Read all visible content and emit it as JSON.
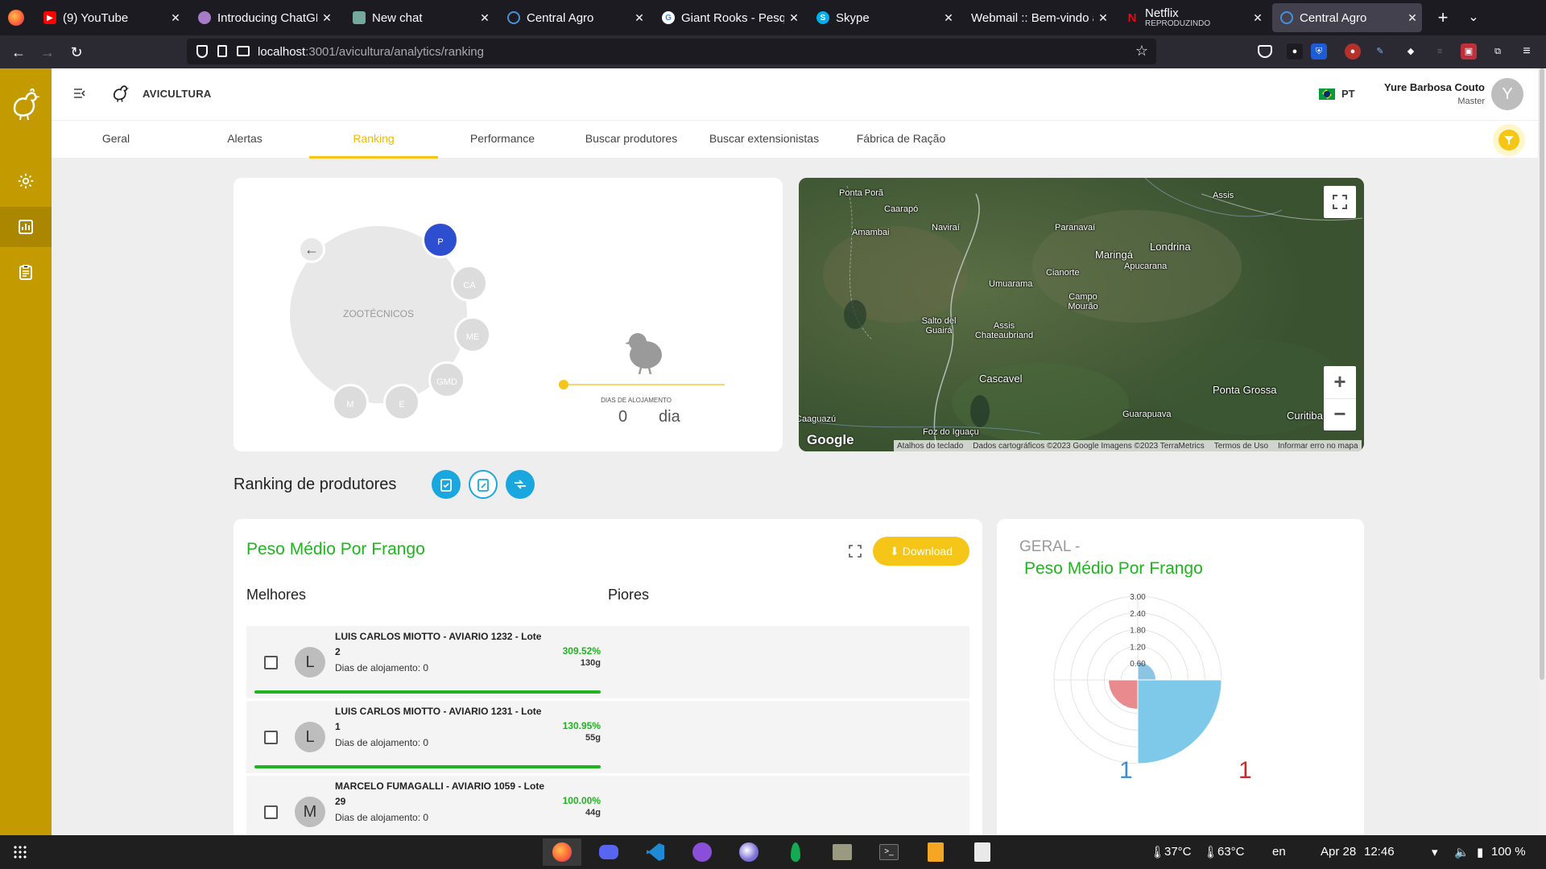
{
  "browser": {
    "tabs": [
      {
        "title": "(9) YouTube",
        "favicon": "youtube-icon",
        "color": "#ff0000"
      },
      {
        "title": "Introducing ChatGPT",
        "favicon": "openai-icon",
        "color": "#a77cc7"
      },
      {
        "title": "New chat",
        "favicon": "chatgpt-icon",
        "color": "#74aa9c"
      },
      {
        "title": "Central Agro",
        "favicon": "central-agro-icon",
        "color": "#4a90d9"
      },
      {
        "title": "Giant Rooks - Pesquisa",
        "favicon": "google-icon",
        "color": "#ffffff"
      },
      {
        "title": "Skype",
        "favicon": "skype-icon",
        "color": "#00aff0"
      },
      {
        "title": "Webmail :: Bem-vindo a",
        "favicon": "webmail-icon",
        "color": "#888888"
      },
      {
        "title": "Netflix",
        "subtitle": "REPRODUZINDO",
        "favicon": "netflix-icon",
        "color": "#e50914"
      },
      {
        "title": "Central Agro",
        "favicon": "central-agro-icon",
        "color": "#4a90d9"
      }
    ],
    "url_host": "localhost",
    "url_path": ":3001/avicultura/analytics/ranking"
  },
  "app": {
    "module_title": "AVICULTURA",
    "language": "PT",
    "user_name": "Yure Barbosa Couto",
    "user_role": "Master",
    "user_initial": "Y",
    "tabs": [
      "Geral",
      "Alertas",
      "Ranking",
      "Performance",
      "Buscar produtores",
      "Buscar extensionistas",
      "Fábrica de Ração"
    ],
    "active_tab": "Ranking",
    "accent": "#f5c518",
    "sidebar_color": "#c39a00"
  },
  "selector": {
    "center_label": "ZOOTÉCNICOS",
    "options": [
      "P",
      "CA",
      "ME",
      "GMD",
      "E",
      "M"
    ],
    "selected": "P",
    "days_label": "DIAS DE ALOJAMENTO",
    "days_value": "0",
    "days_unit": "dia",
    "slider_value": 0
  },
  "map": {
    "labels": [
      "Ponta Porã",
      "Caarapó",
      "Amambai",
      "Naviraí",
      "Paranavaí",
      "Maringá",
      "Londrina",
      "Apucarana",
      "Assis",
      "Umuarama",
      "Cianorte",
      "Campo Mourão",
      "Salto del Guairá",
      "Assis Chateaubriand",
      "Cascavel",
      "Ponta Grossa",
      "Guarapuava",
      "Foz do Iguaçu",
      "Caaguazú",
      "Curitiba"
    ],
    "logo": "Google",
    "attribution": [
      "Atalhos do teclado",
      "Dados cartográficos ©2023 Google Imagens ©2023 TerraMetrics",
      "Termos de Uso",
      "Informar erro no mapa"
    ],
    "zoom_in": "+",
    "zoom_out": "−"
  },
  "ranking": {
    "heading": "Ranking de produtores",
    "card_title": "Peso Médio Por Frango",
    "download_label": "Download",
    "best_label": "Melhores",
    "worst_label": "Piores",
    "rows": [
      {
        "initial": "L",
        "name": "LUIS CARLOS MIOTTO - AVIARIO 1232 - Lote 2",
        "days": "Dias de alojamento: 0",
        "pct": "309.52%",
        "grams": "130g",
        "bar_fraction": 1.0
      },
      {
        "initial": "L",
        "name": "LUIS CARLOS MIOTTO - AVIARIO 1231 - Lote 1",
        "days": "Dias de alojamento: 0",
        "pct": "130.95%",
        "grams": "55g",
        "bar_fraction": 1.0
      },
      {
        "initial": "M",
        "name": "MARCELO FUMAGALLI - AVIARIO 1059 - Lote 29",
        "days": "Dias de alojamento: 0",
        "pct": "100.00%",
        "grams": "44g",
        "bar_fraction": 1.0
      }
    ]
  },
  "geral": {
    "title_prefix": "GERAL -",
    "title": "Peso Médio Por Frango",
    "footer_left": "1",
    "footer_right": "1"
  },
  "chart_data": {
    "type": "polar-area",
    "title": "",
    "rings": [
      0.6,
      1.2,
      1.8,
      2.4,
      3.0
    ],
    "rlim": [
      0,
      3.0
    ],
    "sectors": [
      {
        "quadrant": "top-right",
        "value": 0.65,
        "color": "#8cc4e3"
      },
      {
        "quadrant": "bottom-right",
        "value": 3.0,
        "color": "#7ec8ea"
      },
      {
        "quadrant": "bottom-left",
        "value": 1.05,
        "color": "#e88a8e"
      },
      {
        "quadrant": "top-left",
        "value": 0,
        "color": "#e88a8e"
      }
    ]
  },
  "taskbar": {
    "temp_cpu": "37°C",
    "temp_gpu": "63°C",
    "lang": "en",
    "date": "Apr 28",
    "time": "12:46",
    "battery": "100 %"
  }
}
